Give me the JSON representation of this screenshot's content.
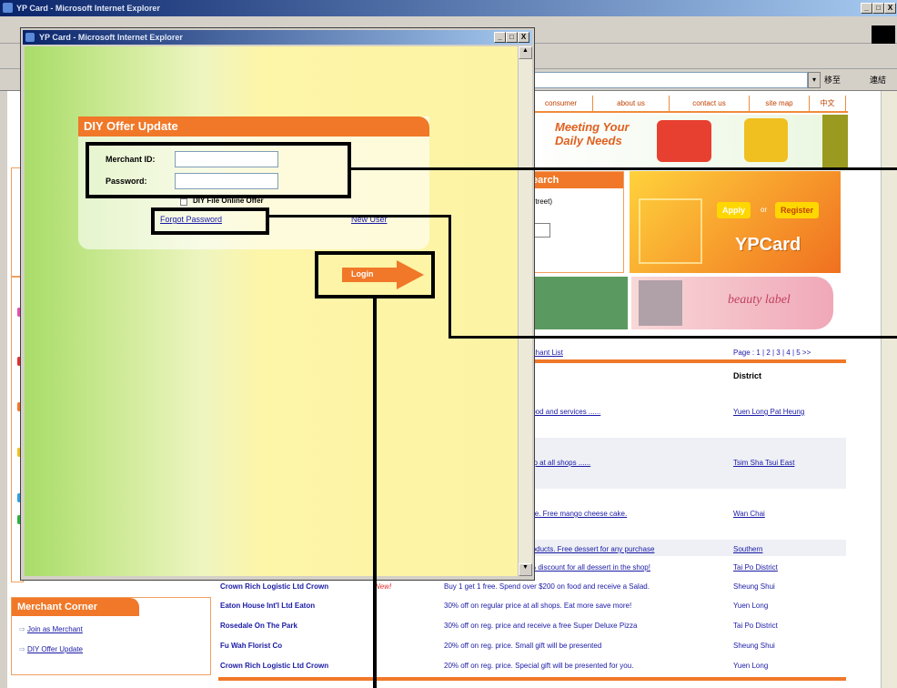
{
  "outer_window": {
    "title": "YP Card - Microsoft Internet Explorer",
    "controls": [
      "_",
      "□",
      "X"
    ],
    "address_buttons": {
      "go": "移至",
      "links": "連結"
    }
  },
  "site": {
    "nav": [
      "consumer",
      "about us",
      "contact us",
      "site map",
      "中文"
    ],
    "banner_text": "Meeting Your Daily Needs",
    "search_heading": "earch",
    "search_label": "Street)",
    "ypcard": {
      "apply": "Apply",
      "or": "or",
      "register": "Register",
      "brand": "YPCard"
    },
    "beauty": "beauty label",
    "list_link": "rchant List",
    "pagination": "Page : 1 | 2 | 3 | 4 | 5 >>",
    "district_header": "District",
    "partial_rows": [
      {
        "offer": "food and services ......",
        "district": "Yuen Long Pat Heung"
      },
      {
        "offer": "op at all shops ......",
        "district": "Tsim Sha Tsui East"
      },
      {
        "offer": "ice. Free mango cheese cake.",
        "district": "Wan Chai"
      },
      {
        "offer": "roducts. Free dessert for any purchase",
        "district": "Southern"
      },
      {
        "offer": "% discount for all dessert in the shop!",
        "district": "Tai Po District"
      }
    ],
    "rows": [
      {
        "merchant": "Crown Rich Logistic Ltd Crown",
        "badge": "New!",
        "offer": "Buy 1 get 1 free. Spend over $200 on food and receive a Salad.",
        "district": "Sheung Shui"
      },
      {
        "merchant": "Eaton House Int'l Ltd Eaton",
        "badge": "",
        "offer": "30% off on regular price at all shops. Eat more save more!",
        "district": "Yuen Long"
      },
      {
        "merchant": "Rosedale On The Park",
        "badge": "",
        "offer": "30% off on reg. price and receive a free Super Deluxe Pizza",
        "district": "Tai Po District"
      },
      {
        "merchant": "Fu Wah Florist Co",
        "badge": "",
        "offer": "20% off on reg. price. Small gift will be presented",
        "district": "Sheung Shui"
      },
      {
        "merchant": "Crown Rich Logistic Ltd Crown",
        "badge": "",
        "offer": "20% off on reg. price. Special gift will be presented for you.",
        "district": "Yuen Long"
      }
    ],
    "merchant_corner": {
      "title": "Merchant Corner",
      "items": [
        "Join as Merchant",
        "DIY Offer Update"
      ]
    }
  },
  "popup": {
    "title": "YP Card - Microsoft Internet Explorer",
    "controls": [
      "_",
      "□",
      "X"
    ],
    "panel_title": "DIY Offer Update",
    "merchant_label": "Merchant ID:",
    "password_label": "Password:",
    "remember": "DIY File Online Offer",
    "forgot": "Forgot Password",
    "new_user": "New User",
    "login": "Login",
    "merchant_value": "",
    "password_value": ""
  },
  "colors": {
    "accent": "#f07828",
    "popup_gradient": [
      "#a8dc70",
      "#fdf5a8"
    ],
    "brand_yellow": "#ffd700"
  }
}
